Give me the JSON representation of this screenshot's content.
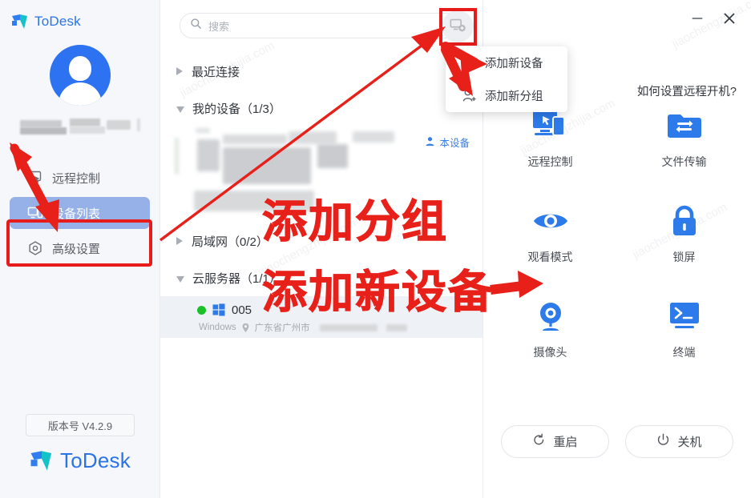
{
  "app": {
    "title": "ToDesk",
    "logo_text": "ToDesk",
    "accent": "#2b74e8"
  },
  "window_controls": {
    "minimize": "–",
    "close": "✕"
  },
  "sidebar": {
    "version_badge": "版本号 V4.2.9",
    "footer_logo": "ToDesk",
    "items": [
      {
        "label": "远程控制",
        "icon": "remote-control-icon",
        "active": false
      },
      {
        "label": "设备列表",
        "icon": "device-list-icon",
        "active": true
      },
      {
        "label": "高级设置",
        "icon": "advanced-settings-icon",
        "active": false
      }
    ]
  },
  "search": {
    "placeholder": "搜索",
    "value": ""
  },
  "add_menu": {
    "button_icon": "add-device-icon",
    "items": [
      {
        "label": "添加新设备",
        "icon": "add-device-menu-icon"
      },
      {
        "label": "添加新分组",
        "icon": "add-group-menu-icon"
      }
    ]
  },
  "device_groups": [
    {
      "name": "最近连接",
      "count": "",
      "expanded": false,
      "label": "最近连接"
    },
    {
      "name": "我的设备",
      "count": "（1/3）",
      "expanded": true,
      "label": "我的设备（1/3）"
    },
    {
      "name": "局域网",
      "count": "（0/2）",
      "expanded": false,
      "label": "局域网（0/2）"
    },
    {
      "name": "云服务器",
      "count": "（1/1）",
      "expanded": true,
      "label": "云服务器（1/1）"
    }
  ],
  "this_device_badge": "本设备",
  "devices": [
    {
      "name": "005",
      "os": "Windows",
      "location": "广东省广州市",
      "status": "online",
      "selected": true
    }
  ],
  "right_panel": {
    "how_to_link": "如何设置远程开机?",
    "actions": [
      {
        "label": "远程控制",
        "icon": "remote-control-action-icon"
      },
      {
        "label": "文件传输",
        "icon": "file-transfer-icon"
      },
      {
        "label": "观看模式",
        "icon": "watch-mode-eye-icon"
      },
      {
        "label": "锁屏",
        "icon": "lock-screen-icon"
      },
      {
        "label": "摄像头",
        "icon": "webcam-icon"
      },
      {
        "label": "终端",
        "icon": "terminal-icon"
      }
    ],
    "power": [
      {
        "label": "重启",
        "icon": "restart-icon"
      },
      {
        "label": "关机",
        "icon": "power-off-icon"
      }
    ]
  },
  "annotations": {
    "color": "#e8201a",
    "texts": [
      "添加分组",
      "添加新设备"
    ]
  },
  "watermarks": [
    "jiaochengzhijia.com",
    "jiaochengzhijia.com",
    "jiaochengzhijia.com",
    "jiaochengzhijia.com"
  ]
}
